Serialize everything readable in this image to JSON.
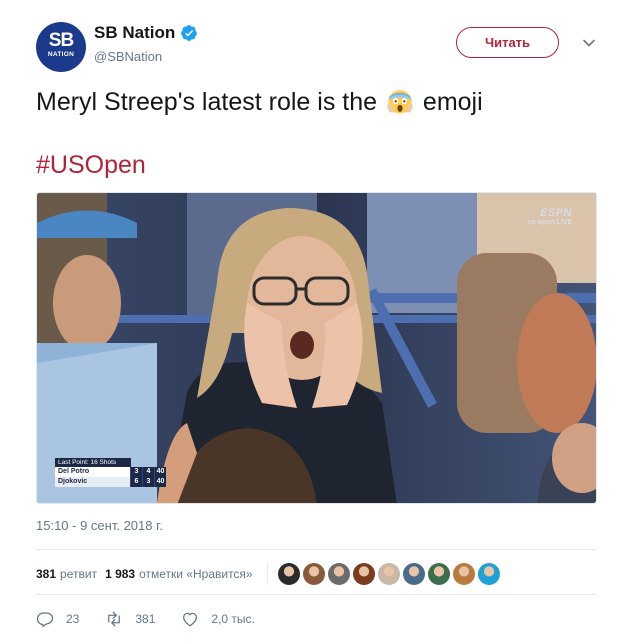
{
  "account": {
    "name": "SB Nation",
    "handle": "@SBNation",
    "avatar_text_big": "SB",
    "avatar_text_small": "NATION",
    "verified": true,
    "brand_color": "#1b3a8c"
  },
  "header": {
    "follow_label": "Читать",
    "follow_color": "#b0243a",
    "menu_icon": "chevron-down-icon"
  },
  "tweet": {
    "text_before": "Meryl Streep's latest role is the",
    "emoji_name": "face-screaming-in-fear-emoji",
    "text_after": "emoji",
    "hashtag": "#USOpen"
  },
  "media": {
    "scoreboard": {
      "header": "Last Point: 16 Shots",
      "players": [
        {
          "name": "Del Potro",
          "country": "ARG",
          "scores": [
            "3",
            "4",
            "40"
          ]
        },
        {
          "name": "Djokovic",
          "country": "SRB",
          "scores": [
            "6",
            "3",
            "40"
          ]
        }
      ]
    },
    "broadcast_logo": "ESPN",
    "broadcast_sub": "us open  LIVE"
  },
  "timestamp": "15:10 - 9 сент. 2018 г.",
  "stats": {
    "retweets_count": "381",
    "retweets_label": "ретвит",
    "likes_count": "1 983",
    "likes_label": "отметки «Нравится»",
    "liker_avatar_colors": [
      "#2b2b2b",
      "#8a5a3c",
      "#6b6b6b",
      "#7a3b1e",
      "#c9b8a6",
      "#4a6b8a",
      "#3b6e4f",
      "#b97a3e",
      "#1fa0d6"
    ]
  },
  "actions": {
    "reply_count": "23",
    "retweet_count": "381",
    "like_count": "2,0 тыс.",
    "icons": [
      "reply-icon",
      "retweet-icon",
      "heart-icon"
    ]
  }
}
